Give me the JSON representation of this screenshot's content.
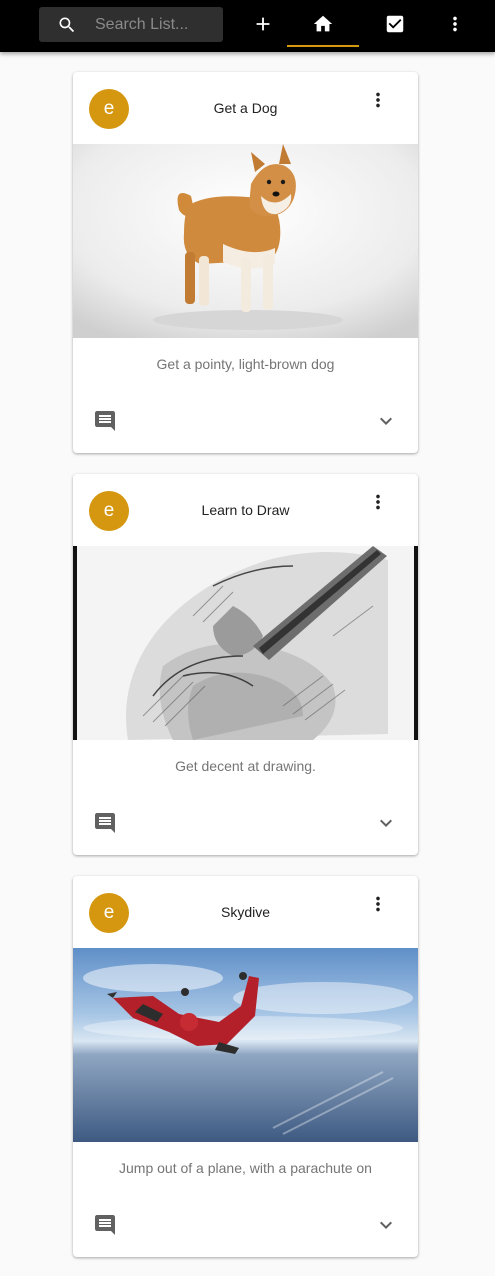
{
  "colors": {
    "topbar_bg": "#000000",
    "search_bg": "#2f2f2f",
    "accent": "#d4970f",
    "avatar": "#d4970f",
    "card_bg": "#ffffff",
    "page_bg": "#fafafa"
  },
  "topbar": {
    "search": {
      "placeholder": "Search List...",
      "value": "",
      "icon": "search-icon"
    },
    "nav": [
      {
        "name": "add",
        "icon": "plus-icon"
      },
      {
        "name": "home",
        "icon": "home-icon",
        "active": true
      },
      {
        "name": "completed",
        "icon": "checkbox-icon"
      },
      {
        "name": "more",
        "icon": "more-vert-icon"
      }
    ]
  },
  "cards": [
    {
      "avatar_letter": "e",
      "title": "Get a Dog",
      "image": "shiba-inu-dog",
      "description": "Get a pointy, light-brown dog"
    },
    {
      "avatar_letter": "e",
      "title": "Learn to Draw",
      "image": "pencil-sketch-hand",
      "description": "Get decent at drawing."
    },
    {
      "avatar_letter": "e",
      "title": "Skydive",
      "image": "skydiver-freefall",
      "description": "Jump out of a plane, with a parachute on"
    }
  ]
}
